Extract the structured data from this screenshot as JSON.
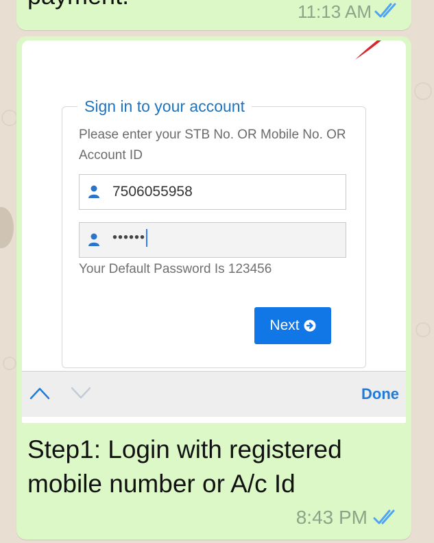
{
  "chat": {
    "previous_message": {
      "text_fragment": "payment.",
      "time": "11:13 AM",
      "status_icon": "double-check-icon"
    },
    "image_message": {
      "caption": "Step1: Login with registered mobile number or A/c Id",
      "time": "8:43 PM",
      "status_icon": "double-check-icon"
    }
  },
  "screenshot": {
    "form_title": "Sign in to your account",
    "instruction": "Please enter your STB No. OR Mobile No. OR Account ID",
    "id_field": {
      "value": "7506055958",
      "icon": "user-icon"
    },
    "password_field": {
      "value": "••••••",
      "icon": "user-icon"
    },
    "password_note": "Your Default Password Is 123456",
    "next_button": {
      "label": "Next",
      "icon": "arrow-circle-right-icon"
    },
    "keyboard_toolbar": {
      "up_icon": "chevron-up-icon",
      "down_icon": "chevron-down-icon",
      "done_label": "Done"
    }
  },
  "colors": {
    "bubble_green": "#dcf8c6",
    "link_blue": "#1e73be",
    "button_blue": "#1177e6",
    "tick_blue": "#4fa3f7",
    "chat_background": "#e8dfd2"
  }
}
